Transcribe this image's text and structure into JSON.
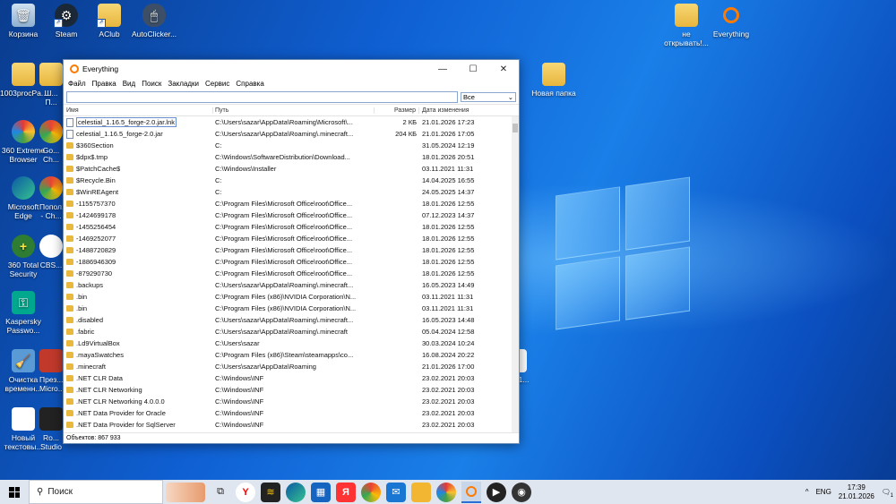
{
  "desktop": {
    "icons": [
      {
        "label": "Корзина"
      },
      {
        "label": "Steam"
      },
      {
        "label": "AClub"
      },
      {
        "label": "AutoClicker..."
      },
      {
        "label": "1003procPa..."
      },
      {
        "label": "Ш... П..."
      },
      {
        "label": "360 Extreme Browser"
      },
      {
        "label": "Go... Ch..."
      },
      {
        "label": "Microsoft Edge"
      },
      {
        "label": "Попол... - Ch..."
      },
      {
        "label": "360 Total Security"
      },
      {
        "label": "CBS..."
      },
      {
        "label": "Kaspersky Passwo..."
      },
      {
        "label": "Очистка временн..."
      },
      {
        "label": "През... Micro..."
      },
      {
        "label": "Новый текстовы..."
      },
      {
        "label": "Ro... Studio"
      },
      {
        "label": "не открывать!..."
      },
      {
        "label": "Everything"
      },
      {
        "label": "Новая папка"
      },
      {
        "label": "1.1..."
      }
    ]
  },
  "window": {
    "title": "Everything",
    "controls": {
      "minimize": "—",
      "maximize": "☐",
      "close": "✕"
    },
    "menu": [
      "Файл",
      "Правка",
      "Вид",
      "Поиск",
      "Закладки",
      "Сервис",
      "Справка"
    ],
    "search": {
      "value": "",
      "filter": "Все"
    },
    "columns": {
      "name": "Имя",
      "path": "Путь",
      "size": "Размер",
      "date": "Дата изменения"
    },
    "rows": [
      {
        "name": "celestial_1.16.5_forge-2.0.jar.lnk",
        "path": "C:\\Users\\sazar\\AppData\\Roaming\\Microsoft\\...",
        "size": "2 КБ",
        "date": "21.01.2026 17:23",
        "type": "file"
      },
      {
        "name": "celestial_1.16.5_forge-2.0.jar",
        "path": "C:\\Users\\sazar\\AppData\\Roaming\\.minecraft...",
        "size": "204 КБ",
        "date": "21.01.2026 17:05",
        "type": "file"
      },
      {
        "name": "$360Section",
        "path": "C:",
        "size": "",
        "date": "31.05.2024 12:19",
        "type": "folder"
      },
      {
        "name": "$dpx$.tmp",
        "path": "C:\\Windows\\SoftwareDistribution\\Download...",
        "size": "",
        "date": "18.01.2026 20:51",
        "type": "folder"
      },
      {
        "name": "$PatchCache$",
        "path": "C:\\Windows\\Installer",
        "size": "",
        "date": "03.11.2021 11:31",
        "type": "folder"
      },
      {
        "name": "$Recycle.Bin",
        "path": "C:",
        "size": "",
        "date": "14.04.2025 16:55",
        "type": "folder"
      },
      {
        "name": "$WinREAgent",
        "path": "C:",
        "size": "",
        "date": "24.05.2025 14:37",
        "type": "folder"
      },
      {
        "name": "-1155757370",
        "path": "C:\\Program Files\\Microsoft Office\\root\\Office...",
        "size": "",
        "date": "18.01.2026 12:55",
        "type": "folder"
      },
      {
        "name": "-1424699178",
        "path": "C:\\Program Files\\Microsoft Office\\root\\Office...",
        "size": "",
        "date": "07.12.2023 14:37",
        "type": "folder"
      },
      {
        "name": "-1455256454",
        "path": "C:\\Program Files\\Microsoft Office\\root\\Office...",
        "size": "",
        "date": "18.01.2026 12:55",
        "type": "folder"
      },
      {
        "name": "-1469252077",
        "path": "C:\\Program Files\\Microsoft Office\\root\\Office...",
        "size": "",
        "date": "18.01.2026 12:55",
        "type": "folder"
      },
      {
        "name": "-1488720829",
        "path": "C:\\Program Files\\Microsoft Office\\root\\Office...",
        "size": "",
        "date": "18.01.2026 12:55",
        "type": "folder"
      },
      {
        "name": "-1886946309",
        "path": "C:\\Program Files\\Microsoft Office\\root\\Office...",
        "size": "",
        "date": "18.01.2026 12:55",
        "type": "folder"
      },
      {
        "name": "-879290730",
        "path": "C:\\Program Files\\Microsoft Office\\root\\Office...",
        "size": "",
        "date": "18.01.2026 12:55",
        "type": "folder"
      },
      {
        "name": ".backups",
        "path": "C:\\Users\\sazar\\AppData\\Roaming\\.minecraft...",
        "size": "",
        "date": "16.05.2023 14:49",
        "type": "folder"
      },
      {
        "name": ".bin",
        "path": "C:\\Program Files (x86)\\NVIDIA Corporation\\N...",
        "size": "",
        "date": "03.11.2021 11:31",
        "type": "folder"
      },
      {
        "name": ".bin",
        "path": "C:\\Program Files (x86)\\NVIDIA Corporation\\N...",
        "size": "",
        "date": "03.11.2021 11:31",
        "type": "folder"
      },
      {
        "name": ".disabled",
        "path": "C:\\Users\\sazar\\AppData\\Roaming\\.minecraft...",
        "size": "",
        "date": "16.05.2023 14:48",
        "type": "folder"
      },
      {
        "name": ".fabric",
        "path": "C:\\Users\\sazar\\AppData\\Roaming\\.minecraft",
        "size": "",
        "date": "05.04.2024 12:58",
        "type": "folder"
      },
      {
        "name": ".Ld9VirtualBox",
        "path": "C:\\Users\\sazar",
        "size": "",
        "date": "30.03.2024 10:24",
        "type": "folder"
      },
      {
        "name": ".mayaSwatches",
        "path": "C:\\Program Files (x86)\\Steam\\steamapps\\co...",
        "size": "",
        "date": "16.08.2024 20:22",
        "type": "folder"
      },
      {
        "name": ".minecraft",
        "path": "C:\\Users\\sazar\\AppData\\Roaming",
        "size": "",
        "date": "21.01.2026 17:00",
        "type": "folder"
      },
      {
        "name": ".NET CLR Data",
        "path": "C:\\Windows\\INF",
        "size": "",
        "date": "23.02.2021 20:03",
        "type": "folder"
      },
      {
        "name": ".NET CLR Networking",
        "path": "C:\\Windows\\INF",
        "size": "",
        "date": "23.02.2021 20:03",
        "type": "folder"
      },
      {
        "name": ".NET CLR Networking 4.0.0.0",
        "path": "C:\\Windows\\INF",
        "size": "",
        "date": "23.02.2021 20:03",
        "type": "folder"
      },
      {
        "name": ".NET Data Provider for Oracle",
        "path": "C:\\Windows\\INF",
        "size": "",
        "date": "23.02.2021 20:03",
        "type": "folder"
      },
      {
        "name": ".NET Data Provider for SqlServer",
        "path": "C:\\Windows\\INF",
        "size": "",
        "date": "23.02.2021 20:03",
        "type": "folder"
      }
    ],
    "status": "Объектов: 867 933"
  },
  "taskbar": {
    "search_label": "Поиск",
    "language": "ENG",
    "time": "17:39",
    "date": "21.01.2026",
    "tray_chevron": "^",
    "notification_count": "1"
  }
}
